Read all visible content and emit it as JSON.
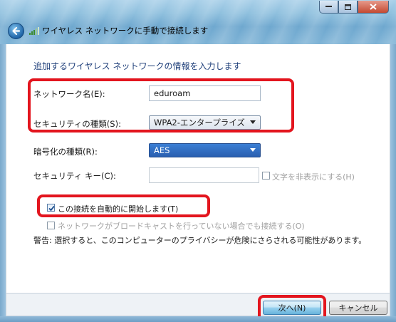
{
  "window": {
    "title": "ワイヤレス ネットワークに手動で接続します"
  },
  "form": {
    "heading": "追加するワイヤレス ネットワークの情報を入力します",
    "network_name": {
      "label": "ネットワーク名(E):",
      "value": "eduroam"
    },
    "security_type": {
      "label": "セキュリティの種類(S):",
      "selected": "WPA2-エンタープライズ"
    },
    "encryption_type": {
      "label": "暗号化の種類(R):",
      "selected": "AES"
    },
    "security_key": {
      "label": "セキュリティ キー(C):",
      "value": "",
      "hide_chars_label": "文字を非表示にする(H)",
      "hide_chars_checked": false
    },
    "auto_connect": {
      "label": "この接続を自動的に開始します(T)",
      "checked": true
    },
    "connect_hidden": {
      "label": "ネットワークがブロードキャストを行っていない場合でも接続する(O)",
      "checked": false
    },
    "warning": "警告: 選択すると、このコンピューターのプライバシーが危険にさらされる可能性があります。"
  },
  "buttons": {
    "next": "次へ(N)",
    "cancel": "キャンセル"
  },
  "colors": {
    "highlight": "#e3151e",
    "heading": "#1f3f7a",
    "select_active": "#2a5fb0"
  }
}
